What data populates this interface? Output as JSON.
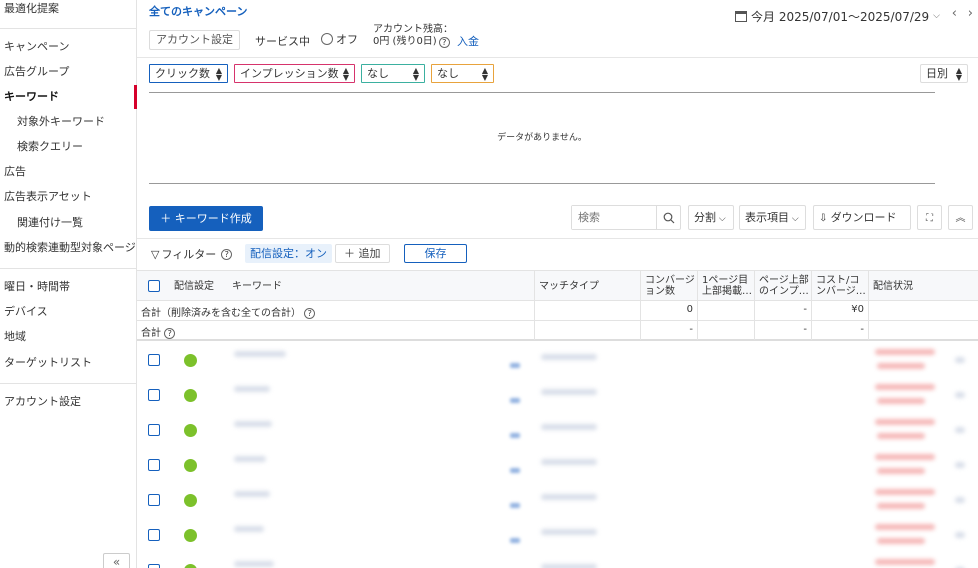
{
  "sidebar": {
    "items": [
      {
        "label": "最適化提案"
      },
      {
        "label": "キャンペーン"
      },
      {
        "label": "広告グループ"
      },
      {
        "label": "キーワード"
      },
      {
        "label": "対象外キーワード"
      },
      {
        "label": "検索クエリー"
      },
      {
        "label": "広告"
      },
      {
        "label": "広告表示アセット"
      },
      {
        "label": "関連付け一覧"
      },
      {
        "label": "動的検索連動型対象ページ"
      },
      {
        "label": "曜日・時間帯"
      },
      {
        "label": "デバイス"
      },
      {
        "label": "地域"
      },
      {
        "label": "ターゲットリスト"
      },
      {
        "label": "アカウント設定"
      }
    ],
    "active_item": "キーワード",
    "collapse_label": "«"
  },
  "header": {
    "campaign_title": "全てのキャンペーン",
    "date_range": "今月 2025/07/01〜2025/07/29",
    "prev": "‹",
    "next": "›",
    "account_settings": "アカウント設定",
    "service_label": "サービス中",
    "off_label": "オフ",
    "balance_line1": "アカウント残高：",
    "balance_line2": "0円 (残り0日)",
    "deposit": "入金"
  },
  "metrics": {
    "metric1": "クリック数",
    "metric2": "インプレッション数",
    "metric3": "なし",
    "metric4": "なし",
    "granularity": "日別",
    "colors": {
      "metric1": "#1560bd",
      "metric2": "#d6336c",
      "metric3": "#3bb0a0",
      "metric4": "#e8a33d"
    }
  },
  "chart": {
    "no_data": "データがありません。"
  },
  "toolbar": {
    "create_label": "＋ キーワード作成",
    "search_placeholder": "検索",
    "split_label": "分割",
    "columns_label": "表示項目",
    "download_label": "ダウンロード"
  },
  "filter": {
    "label": "フィルター",
    "chip": "配信設定：オン",
    "add_label": "＋ 追加",
    "save_label": "保存"
  },
  "table": {
    "headers": {
      "status": "配信設定",
      "keyword": "キーワード",
      "match_type": "マッチタイプ",
      "conversions": "コンバージョン数",
      "top_impr": "1ページ目上部掲載…",
      "top_impr_share": "ページ上部のインプ…",
      "cost_per_conv": "コスト/コンバージ…",
      "delivery_status": "配信状況"
    },
    "summary": [
      {
        "label": "合計（削除済みを含む全ての合計）",
        "conversions": "0",
        "top_impr": "",
        "top_impr_share": "-",
        "cost_per_conv": "¥0"
      },
      {
        "label": "合計",
        "conversions": "-",
        "top_impr": "",
        "top_impr_share": "-",
        "cost_per_conv": "-"
      }
    ]
  }
}
